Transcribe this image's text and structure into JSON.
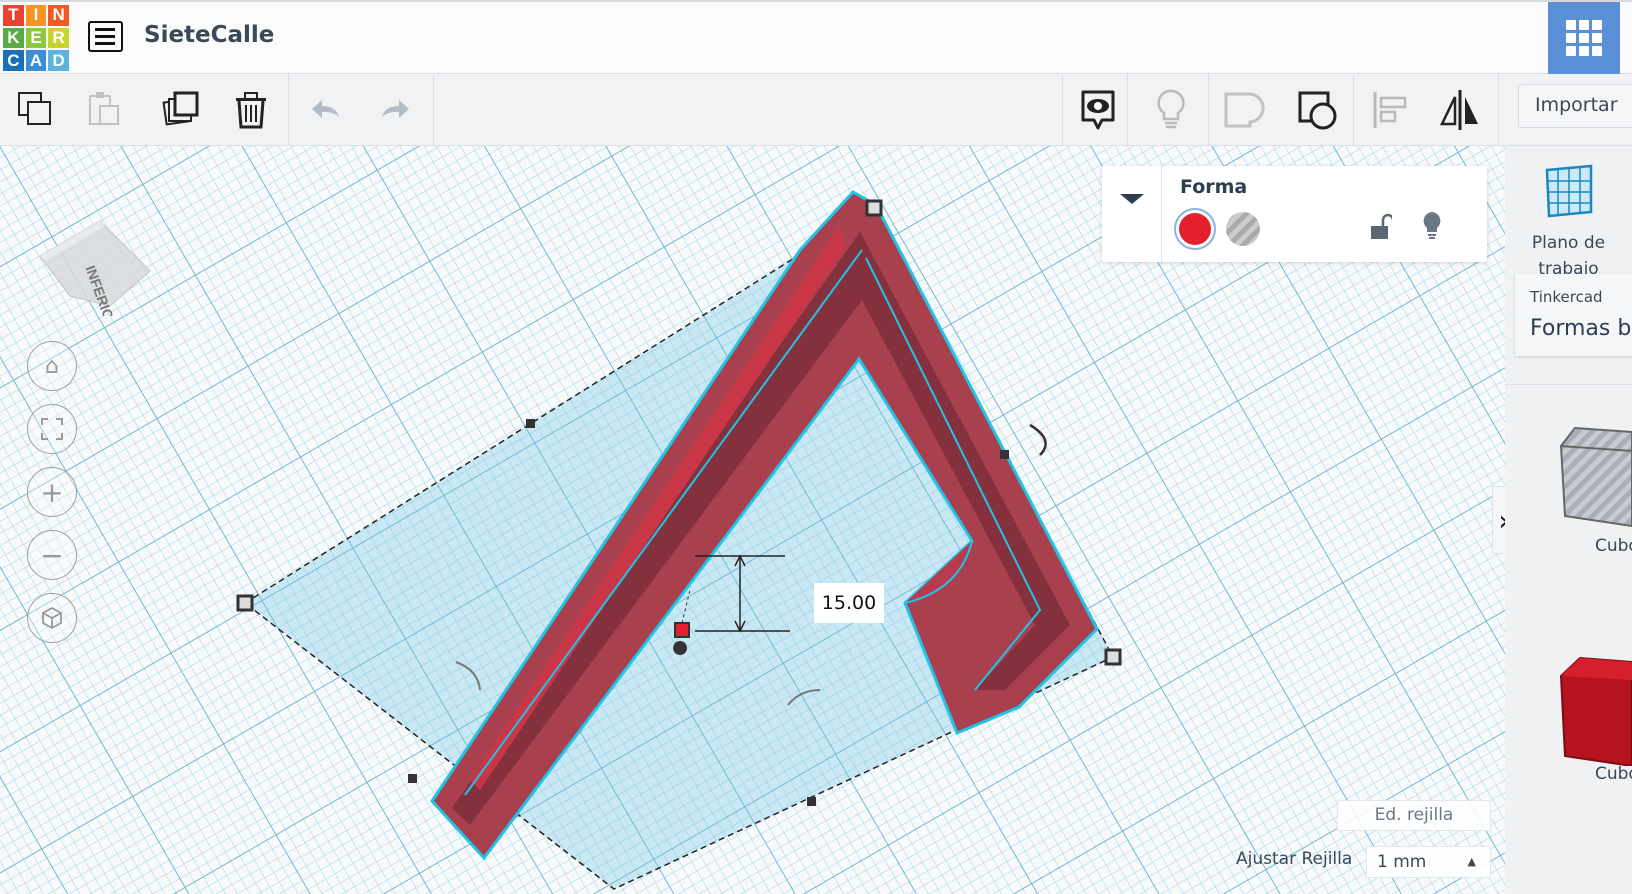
{
  "header": {
    "logo_letters": [
      "T",
      "I",
      "N",
      "K",
      "E",
      "R",
      "C",
      "A",
      "D"
    ],
    "logo_colors": [
      "#e8432e",
      "#f7931e",
      "#f15a24",
      "#5aaa46",
      "#8dc63f",
      "#c7d52b",
      "#1a6fb5",
      "#3b8ed3",
      "#5bb3e0"
    ],
    "project_title": "SieteCalle",
    "menu_icon": "list-icon",
    "apps_icon": "grid-apps-icon",
    "apps_color": "#5b8fd6"
  },
  "toolbar": {
    "left_tools": [
      "copy",
      "paste",
      "duplicate",
      "delete",
      "undo",
      "redo"
    ],
    "right_tools": [
      "notes-visibility",
      "hint",
      "group",
      "ungroup-solid",
      "align",
      "mirror"
    ],
    "import_label": "Importar"
  },
  "viewport": {
    "viewcube_label": "INFERIOR",
    "nav_buttons": [
      "home",
      "fit-view",
      "zoom-in",
      "zoom-out",
      "ortho-view"
    ],
    "dimension_value": "15.00",
    "edit_grid_label": "Ed. rejilla",
    "snap_grid_label": "Ajustar Rejilla",
    "snap_grid_value": "1 mm"
  },
  "inspector": {
    "title": "Forma",
    "solid_color": "#e5202e",
    "options": [
      "solid",
      "hole",
      "lock",
      "light"
    ]
  },
  "sidebar": {
    "workplane_label": "Plano de trabajo",
    "library_source": "Tinkercad",
    "library_name": "Formas básicas",
    "shapes": [
      {
        "label": "Cubo"
      },
      {
        "label": "Cubo"
      }
    ]
  }
}
